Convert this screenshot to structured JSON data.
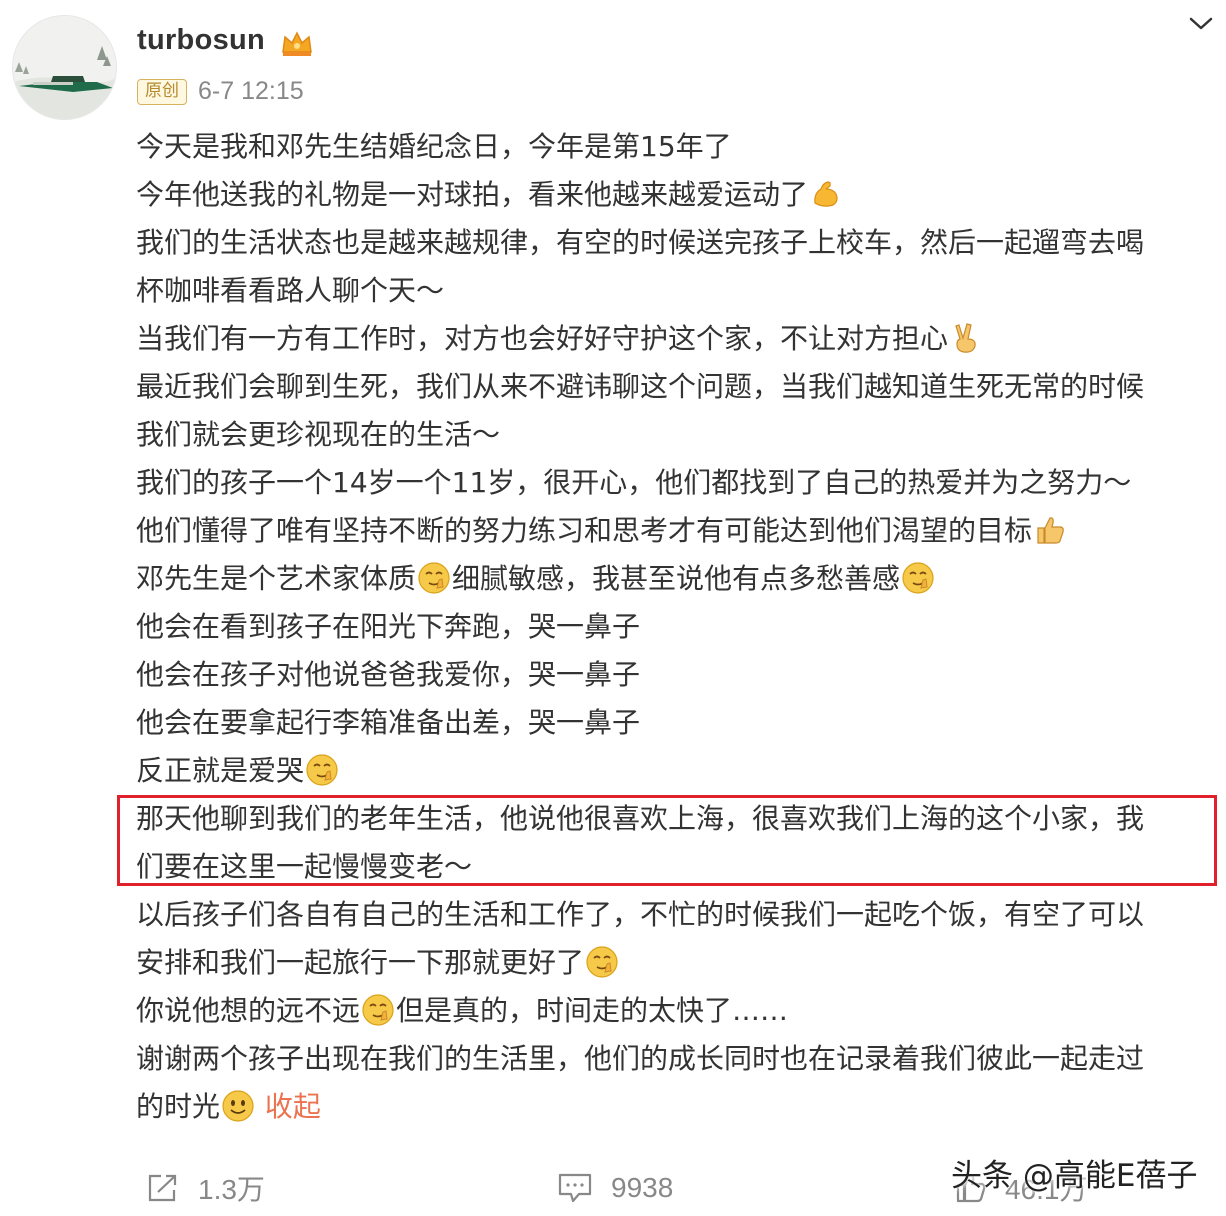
{
  "author": {
    "name": "turbosun",
    "original_badge": "原创",
    "time": "6-7 12:15"
  },
  "post": {
    "lines": [
      "今天是我和邓先生结婚纪念日，今年是第15年了",
      "今年他送我的礼物是一对球拍，看来他越来越爱运动了",
      "我们的生活状态也是越来越规律，有空的时候送完孩子上校车，然后一起遛弯去喝",
      "杯咖啡看看路人聊个天～",
      "当我们有一方有工作时，对方也会好好守护这个家，不让对方担心",
      "最近我们会聊到生死，我们从来不避讳聊这个问题，当我们越知道生死无常的时候",
      "我们就会更珍视现在的生活～",
      "我们的孩子一个14岁一个11岁，很开心，他们都找到了自己的热爱并为之努力～",
      "他们懂得了唯有坚持不断的努力练习和思考才有可能达到他们渴望的目标",
      "邓先生是个艺术家体质",
      "细腻敏感，我甚至说他有点多愁善感",
      "他会在看到孩子在阳光下奔跑，哭一鼻子",
      "他会在孩子对他说爸爸我爱你，哭一鼻子",
      "他会在要拿起行李箱准备出差，哭一鼻子",
      "反正就是爱哭",
      "那天他聊到我们的老年生活，他说他很喜欢上海，很喜欢我们上海的这个小家，我",
      "们要在这里一起慢慢变老～",
      "以后孩子们各自有自己的生活和工作了，不忙的时候我们一起吃个饭，有空了可以",
      "安排和我们一起旅行一下那就更好了",
      "你说他想的远不远",
      "但是真的，时间走的太快了……",
      "谢谢两个孩子出现在我们的生活里，他们的成长同时也在记录着我们彼此一起走过",
      "的时光"
    ],
    "collapse_label": "收起"
  },
  "actions": {
    "repost_count": "1.3万",
    "comment_count": "9938",
    "like_count": "46.1万"
  },
  "watermark": "头条 @高能E蓓子",
  "colors": {
    "highlight_border": "#e0212b",
    "link": "#eb7350",
    "meta_gray": "#888888",
    "emoji_yellow": "#f7c948"
  },
  "icons": [
    "crown-icon",
    "chevron-down-icon",
    "muscle-emoji-icon",
    "victory-hand-emoji-icon",
    "thumbs-up-emoji-icon",
    "heh-emoji-icon",
    "smile-emoji-icon",
    "repost-icon",
    "comment-icon",
    "like-icon"
  ]
}
